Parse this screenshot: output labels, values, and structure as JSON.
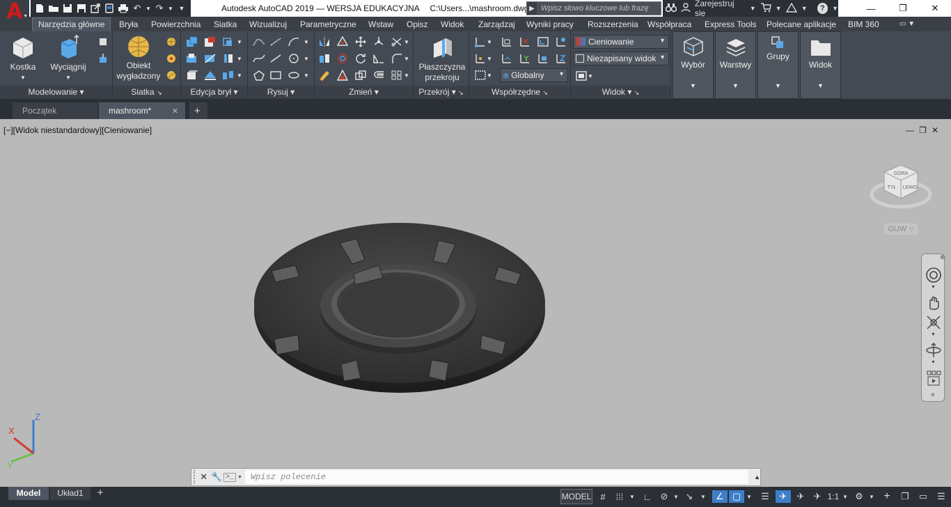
{
  "titlebar": {
    "app_title": "Autodesk AutoCAD 2019 — WERSJA EDUKACYJNA",
    "file_path": "C:\\Users...\\mashroom.dwg",
    "search_placeholder": "Wpisz słowo kluczowe lub frazę",
    "signin_label": "Zarejestruj się"
  },
  "ribbon_tabs": [
    "Narzędzia główne",
    "Bryła",
    "Powierzchnia",
    "Siatka",
    "Wizualizuj",
    "Parametryczne",
    "Wstaw",
    "Opisz",
    "Widok",
    "Zarządzaj",
    "Wyniki pracy",
    "Rozszerzenia",
    "Współpraca",
    "Express Tools",
    "Polecane aplikacje",
    "BIM 360"
  ],
  "ribbon": {
    "kostka": "Kostka",
    "wyciagnij": "Wyciągnij",
    "obiekt_line1": "Obiekt",
    "obiekt_line2": "wygładzony",
    "plaszczyzna_line1": "Płaszczyzna",
    "plaszczyzna_line2": "przekroju",
    "visual_style": "Cieniowanie",
    "named_view": "Niezapisany widok",
    "ucs": "Globalny",
    "wybor": "Wybór",
    "warstwy": "Warstwy",
    "grupy": "Grupy",
    "widok_btn": "Widok",
    "panels": {
      "modelowanie": "Modelowanie",
      "siatka": "Siatka",
      "edycja_bryl": "Edycja brył",
      "rysuj": "Rysuj",
      "zmien": "Zmień",
      "przekroj": "Przekrój",
      "wspolrzedne": "Współrzędne",
      "widok": "Widok"
    }
  },
  "file_tabs": {
    "start": "Początek",
    "current": "mashroom*"
  },
  "viewport": {
    "label": "[−][Widok niestandardowy][Cieniowanie]",
    "viewcube_label": "GUW",
    "cube_faces": {
      "top": "GÓRA",
      "left": "TYŁ",
      "right": "LEWO"
    },
    "ucs_z": "Z",
    "ucs_x": "X",
    "ucs_y": "Y"
  },
  "cmdline": {
    "placeholder": "Wpisz polecenie"
  },
  "statusbar": {
    "model_tab": "Model",
    "layout_tab": "Układ1",
    "model_space": "MODEL",
    "scale": "1:1"
  },
  "colors": {
    "chrome_dark": "#2b2f36",
    "ribbon": "#444a53",
    "viewport_bg": "#b9b9b9",
    "accent_blue": "#3d7ec9",
    "autocad_red": "#d11a1a"
  }
}
